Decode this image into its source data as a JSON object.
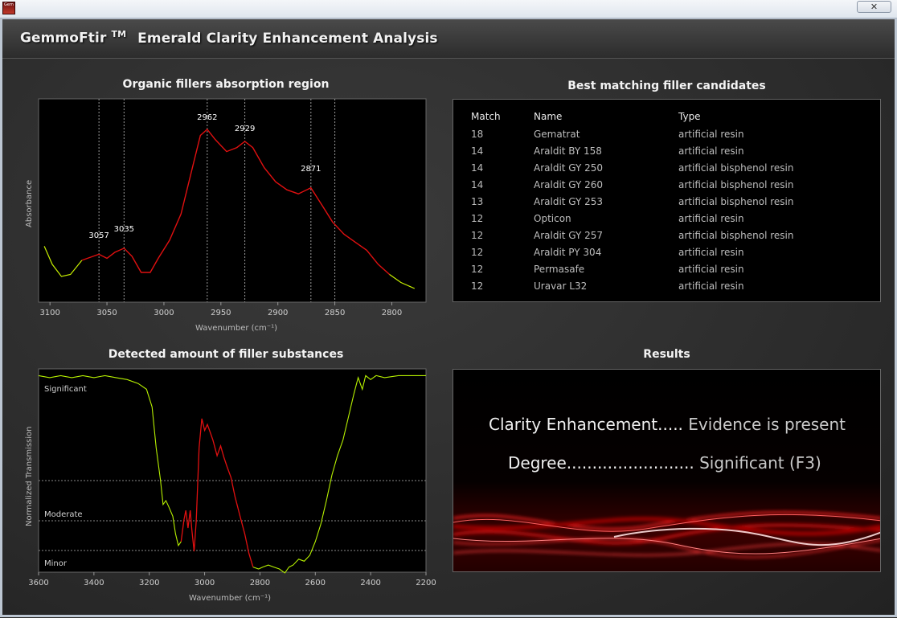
{
  "window": {
    "close_label": "✕",
    "icon_label": "Gem"
  },
  "header": {
    "app_name": "GemmoFtir",
    "trademark": "TM",
    "subtitle": "Emerald Clarity Enhancement Analysis"
  },
  "chart_data": [
    {
      "type": "line",
      "title": "Organic fillers absorption region",
      "xlabel": "Wavenumber (cm⁻¹)",
      "ylabel": "Absorbance",
      "xlim": [
        3110,
        2770
      ],
      "x_ticks": [
        3100,
        3050,
        3000,
        2950,
        2900,
        2850,
        2800
      ],
      "peaks": [
        {
          "x": 3057,
          "label": "3057"
        },
        {
          "x": 3035,
          "label": "3035"
        },
        {
          "x": 2962,
          "label": "2962"
        },
        {
          "x": 2929,
          "label": "2929"
        },
        {
          "x": 2871,
          "label": "2871"
        }
      ],
      "vlines": [
        3057,
        3035,
        2962,
        2929,
        2871,
        2850
      ],
      "grid": false,
      "colors": {
        "baseline": "#c8f000",
        "peak": "#e01010"
      }
    },
    {
      "type": "line",
      "title": "Detected amount of filler substances",
      "xlabel": "Wavenumber (cm⁻¹)",
      "ylabel": "Normalized Transmission",
      "xlim": [
        3600,
        2200
      ],
      "x_ticks": [
        3600,
        3400,
        3200,
        3000,
        2800,
        2600,
        2400,
        2200
      ],
      "levels": [
        "Significant",
        "Moderate",
        "Minor"
      ],
      "colors": {
        "transmission": "#b6f000",
        "filler": "#e01010"
      }
    }
  ],
  "candidates": {
    "title": "Best matching filler candidates",
    "columns": [
      "Match",
      "Name",
      "Type"
    ],
    "rows": [
      [
        "18",
        "Gematrat",
        "artificial resin"
      ],
      [
        "14",
        "Araldit BY 158",
        "artificial resin"
      ],
      [
        "14",
        "Araldit GY 250",
        "artificial bisphenol resin"
      ],
      [
        "14",
        "Araldit GY 260",
        "artificial bisphenol resin"
      ],
      [
        "13",
        "Araldit GY 253",
        "artificial bisphenol resin"
      ],
      [
        "12",
        "Opticon",
        "artificial resin"
      ],
      [
        "12",
        "Araldit GY 257",
        "artificial bisphenol resin"
      ],
      [
        "12",
        "Araldit PY 304",
        "artificial resin"
      ],
      [
        "12",
        "Permasafe",
        "artificial resin"
      ],
      [
        "12",
        "Uravar L32",
        "artificial resin"
      ]
    ]
  },
  "results": {
    "title": "Results",
    "clarity_label": "Clarity Enhancement.....",
    "clarity_value": "Evidence is present",
    "degree_label": "Degree.........................",
    "degree_value": "Significant (F3)"
  }
}
